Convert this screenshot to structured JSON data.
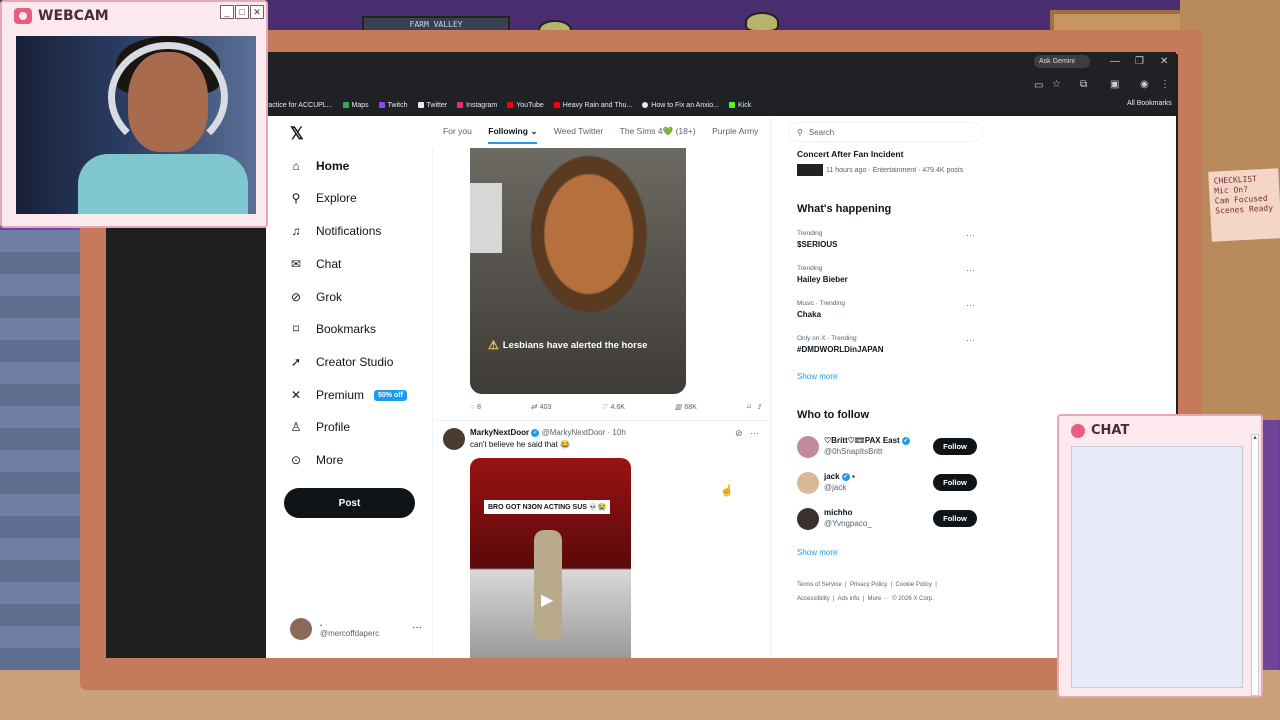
{
  "scene": {
    "banner": "FARM VALLEY",
    "note": [
      "CHECKLIST",
      "Mic On?",
      "Cam Focused",
      "Scenes Ready"
    ]
  },
  "webcam": {
    "title": "WEBCAM",
    "buttons": [
      "_",
      "□",
      "✕"
    ]
  },
  "chat": {
    "title": "CHAT"
  },
  "browser": {
    "ask_gemini": "Ask Gemini",
    "all_bookmarks": "All Bookmarks",
    "bookmarks": [
      {
        "label": "ractice for ACCUPL...",
        "color": "#e8eaed"
      },
      {
        "label": "Maps",
        "color": "#34a853"
      },
      {
        "label": "Twitch",
        "color": "#9146ff"
      },
      {
        "label": "Twitter",
        "color": "#e8eaed"
      },
      {
        "label": "Instagram",
        "color": "#e1306c"
      },
      {
        "label": "YouTube",
        "color": "#ff0000"
      },
      {
        "label": "Heavy Rain and Thu...",
        "color": "#ff0000"
      },
      {
        "label": "How to Fix an Anxio...",
        "color": "#e8eaed"
      },
      {
        "label": "Kick",
        "color": "#53fc18"
      }
    ]
  },
  "nav": {
    "items": [
      {
        "label": "Home",
        "icon": "home-icon"
      },
      {
        "label": "Explore",
        "icon": "search-icon"
      },
      {
        "label": "Notifications",
        "icon": "bell-icon"
      },
      {
        "label": "Chat",
        "icon": "mail-icon"
      },
      {
        "label": "Grok",
        "icon": "grok-icon"
      },
      {
        "label": "Bookmarks",
        "icon": "bookmark-icon"
      },
      {
        "label": "Creator Studio",
        "icon": "rocket-icon"
      },
      {
        "label": "Premium",
        "icon": "x-icon"
      },
      {
        "label": "Profile",
        "icon": "person-icon"
      },
      {
        "label": "More",
        "icon": "more-icon"
      }
    ],
    "premium_badge": "50% off",
    "post_label": "Post",
    "account_name": ".",
    "account_handle": "@mercoffdaperc"
  },
  "feed": {
    "tabs": [
      "For you",
      "Following",
      "Weed Twitter",
      "The Sims 4💚 (18+)",
      "Purple Army"
    ],
    "active_tab": "Following",
    "first_post": {
      "caption": "Lesbians have alerted the horse",
      "replies": "8",
      "reposts": "403",
      "likes": "4.6K",
      "views": "68K"
    },
    "second_post": {
      "name": "MarkyNextDoor",
      "handle": "@MarkyNextDoor",
      "time": "· 10h",
      "text": "can't believe he said that 😂",
      "video_caption": "BRO GOT N3ON ACTING SUS 💀😭"
    }
  },
  "sidebar": {
    "search_placeholder": "Search",
    "news": {
      "title": "Concert After Fan Incident",
      "meta": "11 hours ago · Entertainment · 479.4K posts"
    },
    "whats_happening": "What's happening",
    "trends": [
      {
        "context": "Trending",
        "title": "$SERIOUS"
      },
      {
        "context": "Trending",
        "title": "Hailey Bieber"
      },
      {
        "context": "Music · Trending",
        "title": "Chaka"
      },
      {
        "context": "Only on X · Trending",
        "title": "#DMDWORLDinJAPAN"
      }
    ],
    "show_more": "Show more",
    "who_to_follow": "Who to follow",
    "follow_label": "Follow",
    "suggestions": [
      {
        "name": "♡Britt♡📼PAX East",
        "handle": "@0hSnapItsBritt"
      },
      {
        "name": "jack",
        "handle": "@jack"
      },
      {
        "name": "michho",
        "handle": "@Yvngpaco_"
      }
    ],
    "footer": [
      "Terms of Service",
      "|",
      "Privacy Policy",
      "|",
      "Cookie Policy",
      "|",
      "Accessibility",
      "|",
      "Ads info",
      "|",
      "More ···",
      "© 2026 X Corp."
    ]
  }
}
